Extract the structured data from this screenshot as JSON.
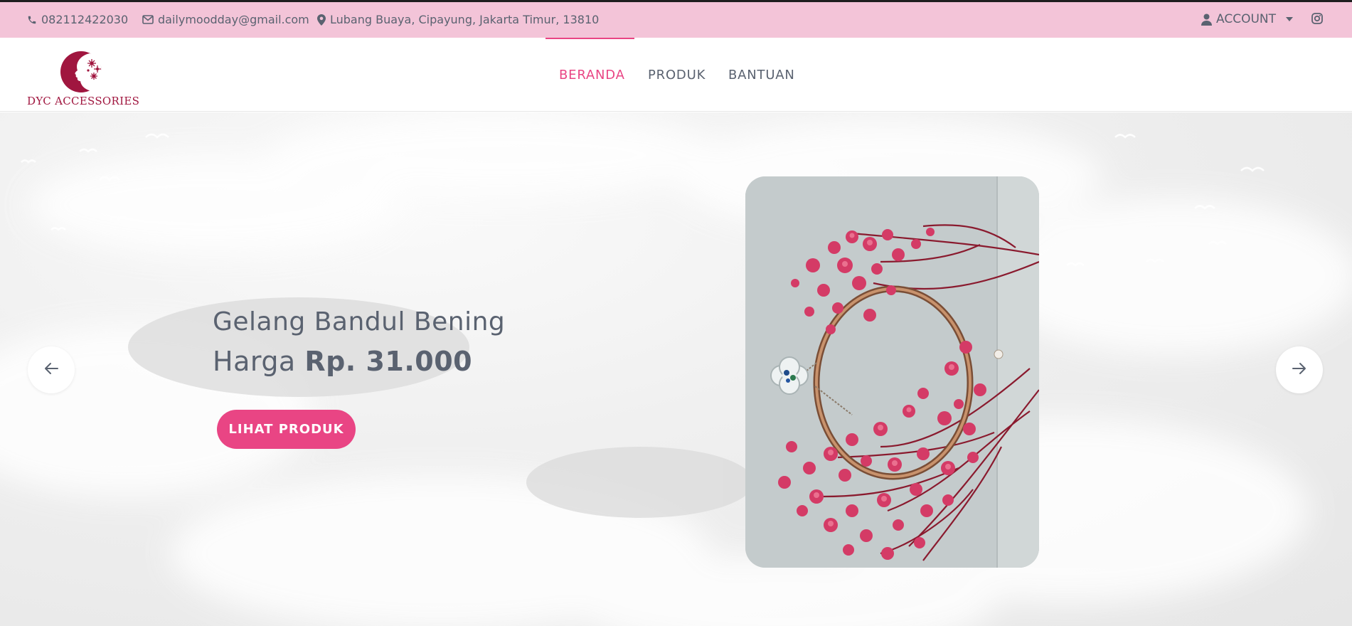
{
  "topbar": {
    "phone": "082112422030",
    "email": "dailymoodday@gmail.com",
    "address": "Lubang Buaya, Cipayung, Jakarta Timur, 13810",
    "account_label": "ACCOUNT",
    "icons": [
      "phone-icon",
      "envelope-icon",
      "map-marker-icon",
      "user-icon",
      "caret-down-icon",
      "instagram-icon"
    ]
  },
  "brand": {
    "name": "DYC ACCESSORIES",
    "color": "#a0163f"
  },
  "nav": {
    "items": [
      {
        "label": "BERANDA",
        "active": true
      },
      {
        "label": "PRODUK",
        "active": false
      },
      {
        "label": "BANTUAN",
        "active": false
      }
    ]
  },
  "hero": {
    "title": "Gelang Bandul Bening",
    "price_prefix": "Harga",
    "price_value": "Rp. 31.000",
    "cta_label": "LIHAT PRODUK",
    "prev_icon": "arrow-left-icon",
    "next_icon": "arrow-right-icon",
    "image_alt": "Gelang bandul bening dengan bunga baby breath merah muda"
  },
  "colors": {
    "accent": "#e94584",
    "topbar_bg": "#f3c4d8",
    "text": "#5a6270"
  }
}
